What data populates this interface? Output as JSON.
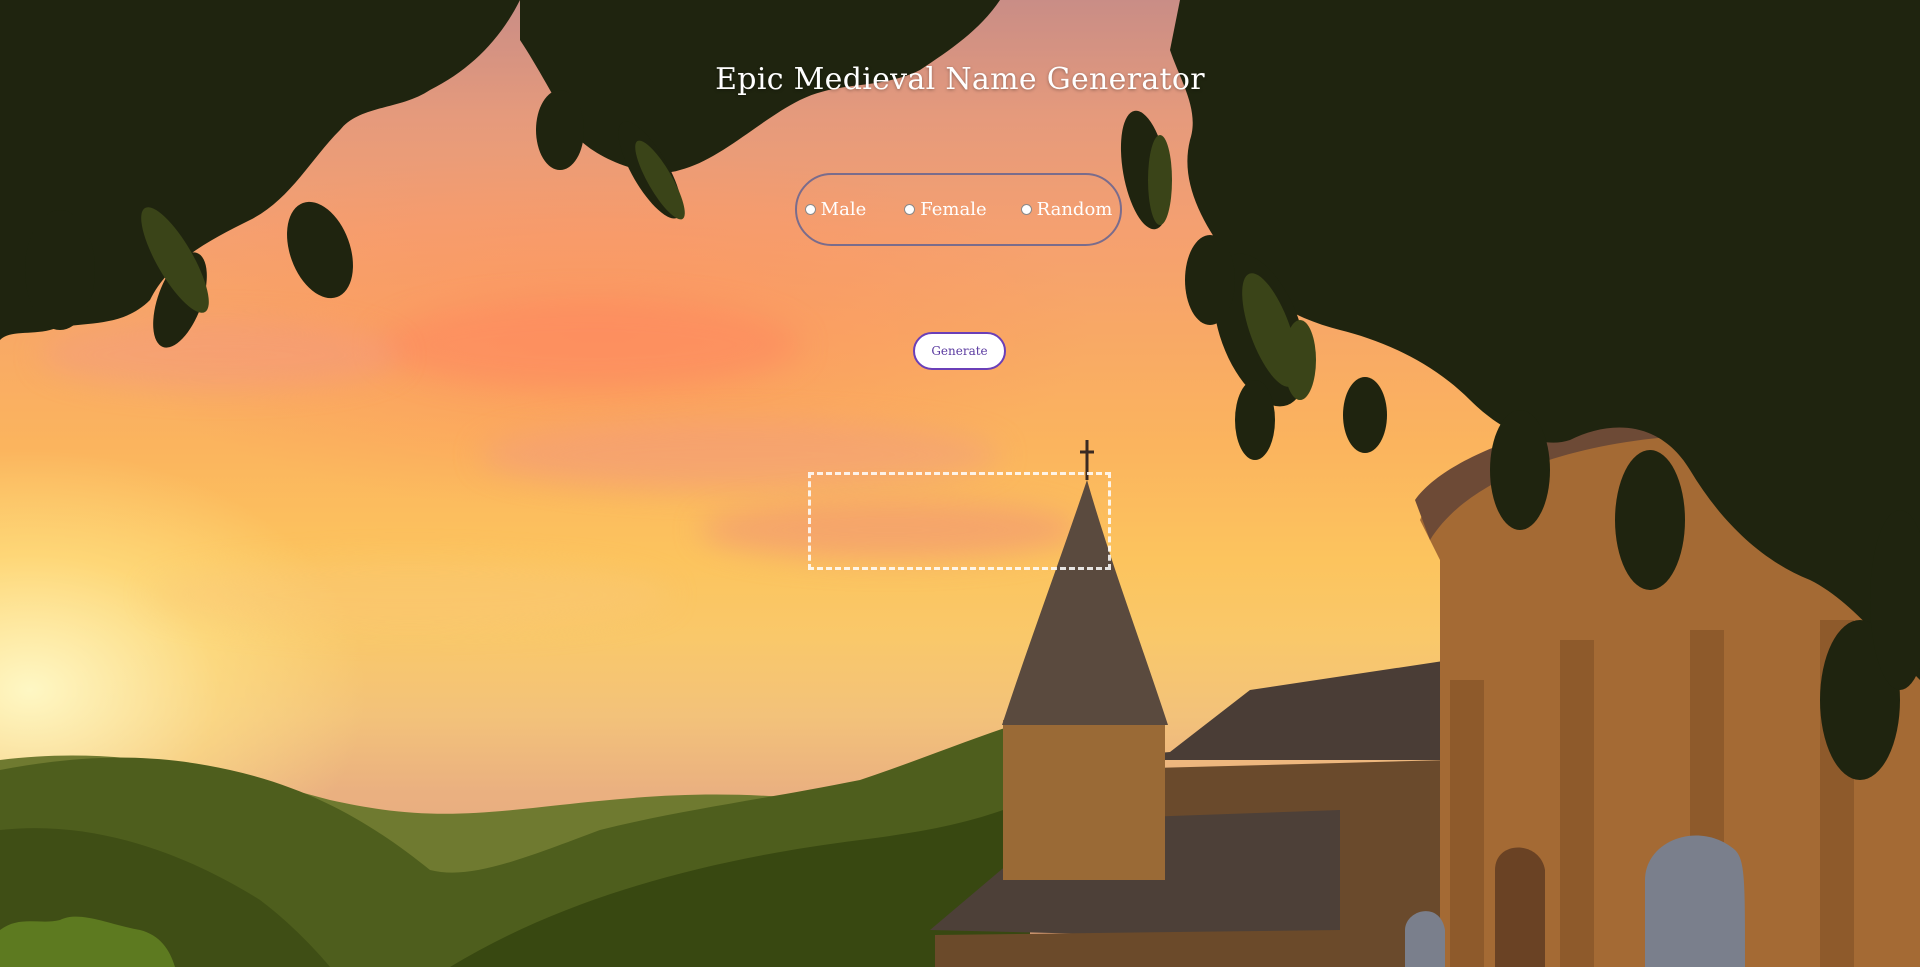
{
  "page": {
    "title": "Epic Medieval Name Generator"
  },
  "gender_options": [
    {
      "label": "Male",
      "selected": false
    },
    {
      "label": "Female",
      "selected": false
    },
    {
      "label": "Random",
      "selected": false
    }
  ],
  "generate_button": {
    "label": "Generate"
  },
  "result": {
    "text": ""
  },
  "colors": {
    "title_text": "#ffffff",
    "radio_group_border": "#7a6c8c",
    "button_border": "#6a3fb8",
    "button_text": "#5a3aa0",
    "result_border": "#ffffff"
  },
  "icons": {
    "radio": "radio-button-icon"
  }
}
